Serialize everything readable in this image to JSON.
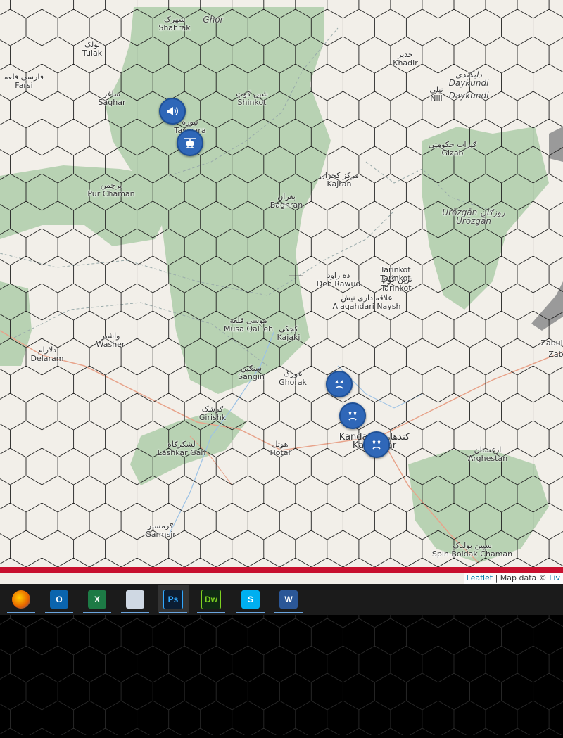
{
  "map": {
    "labels": [
      {
        "name": "Shahrak",
        "local": "شهرک"
      },
      {
        "name": "Ghor",
        "local": ""
      },
      {
        "name": "Tulak",
        "local": "تولک"
      },
      {
        "name": "Farsi",
        "local": "فارسی قلعه"
      },
      {
        "name": "Saghar",
        "local": "ساغر"
      },
      {
        "name": "Shinkot",
        "local": "شین کوټ"
      },
      {
        "name": "Taywara",
        "local": "تیوره"
      },
      {
        "name": "Khadir",
        "local": "خدیر"
      },
      {
        "name": "Daykundi",
        "local": "دایکندی"
      },
      {
        "name": "Daykundi",
        "local": ""
      },
      {
        "name": "Nili",
        "local": "نیلی"
      },
      {
        "name": "Gizab",
        "local": "ګیزاب حکومتی"
      },
      {
        "name": "Pur Chaman",
        "local": "پرچمن"
      },
      {
        "name": "Kajran",
        "local": "مرکز کجران"
      },
      {
        "name": "Baghran",
        "local": "بغران"
      },
      {
        "name": "Urōzgān",
        "local": "Urōzgān روزګان"
      },
      {
        "name": "Deh Rawud",
        "local": "ده راود"
      },
      {
        "name": "Tarinkot",
        "local": "Tarinkot"
      },
      {
        "name": "Tarinkot",
        "local": "ترین کوټ"
      },
      {
        "name": "Alaqahdari Naysh",
        "local": "علاقه داری نیش"
      },
      {
        "name": "Musa Qal`eh",
        "local": "موسی قلعه"
      },
      {
        "name": "Kajaki",
        "local": "کجکی"
      },
      {
        "name": "Washer",
        "local": "واشیر"
      },
      {
        "name": "Delaram",
        "local": "دلارام"
      },
      {
        "name": "Sangin",
        "local": "سنګین"
      },
      {
        "name": "Ghorak",
        "local": "غورک"
      },
      {
        "name": "Girishk",
        "local": "ګرشک"
      },
      {
        "name": "Lashkar Gah",
        "local": "لشکرګاه"
      },
      {
        "name": "Hotal",
        "local": "هوتل"
      },
      {
        "name": "Kandahar",
        "local": "Kandahar کندهار"
      },
      {
        "name": "Arghestan",
        "local": "ارغستان"
      },
      {
        "name": "Garmsir",
        "local": "ګرمسیر"
      },
      {
        "name": "Spin Boldak Chaman",
        "local": "سپین بولدک"
      },
      {
        "name": "Zabul",
        "local": ""
      },
      {
        "name": "Zab",
        "local": ""
      }
    ],
    "markers": [
      {
        "kind": "megaphone-icon"
      },
      {
        "kind": "helicopter-icon"
      },
      {
        "kind": "dead-face-icon"
      },
      {
        "kind": "dead-face-icon"
      },
      {
        "kind": "dead-face-icon"
      }
    ],
    "colors": {
      "land": "#f2efe9",
      "forest": "#b5d0b0",
      "marker": "#2f67b8",
      "hexline": "#111111",
      "border": "#c8102e"
    }
  },
  "attribution": {
    "leaflet": "Leaflet",
    "sep": " | Map data © ",
    "link": "Liv"
  },
  "taskbar": {
    "apps": [
      {
        "name": "Firefox",
        "icon": "firefox-icon",
        "glyph": ""
      },
      {
        "name": "Outlook",
        "icon": "outlook-icon",
        "glyph": "O"
      },
      {
        "name": "Excel",
        "icon": "excel-icon",
        "glyph": "X"
      },
      {
        "name": "Remote Desktop",
        "icon": "remote-desktop-icon",
        "glyph": ""
      },
      {
        "name": "Photoshop",
        "icon": "photoshop-icon",
        "glyph": "Ps"
      },
      {
        "name": "Dreamweaver",
        "icon": "dreamweaver-icon",
        "glyph": "Dw"
      },
      {
        "name": "Skype",
        "icon": "skype-icon",
        "glyph": "S"
      },
      {
        "name": "Word",
        "icon": "word-icon",
        "glyph": "W"
      }
    ]
  }
}
